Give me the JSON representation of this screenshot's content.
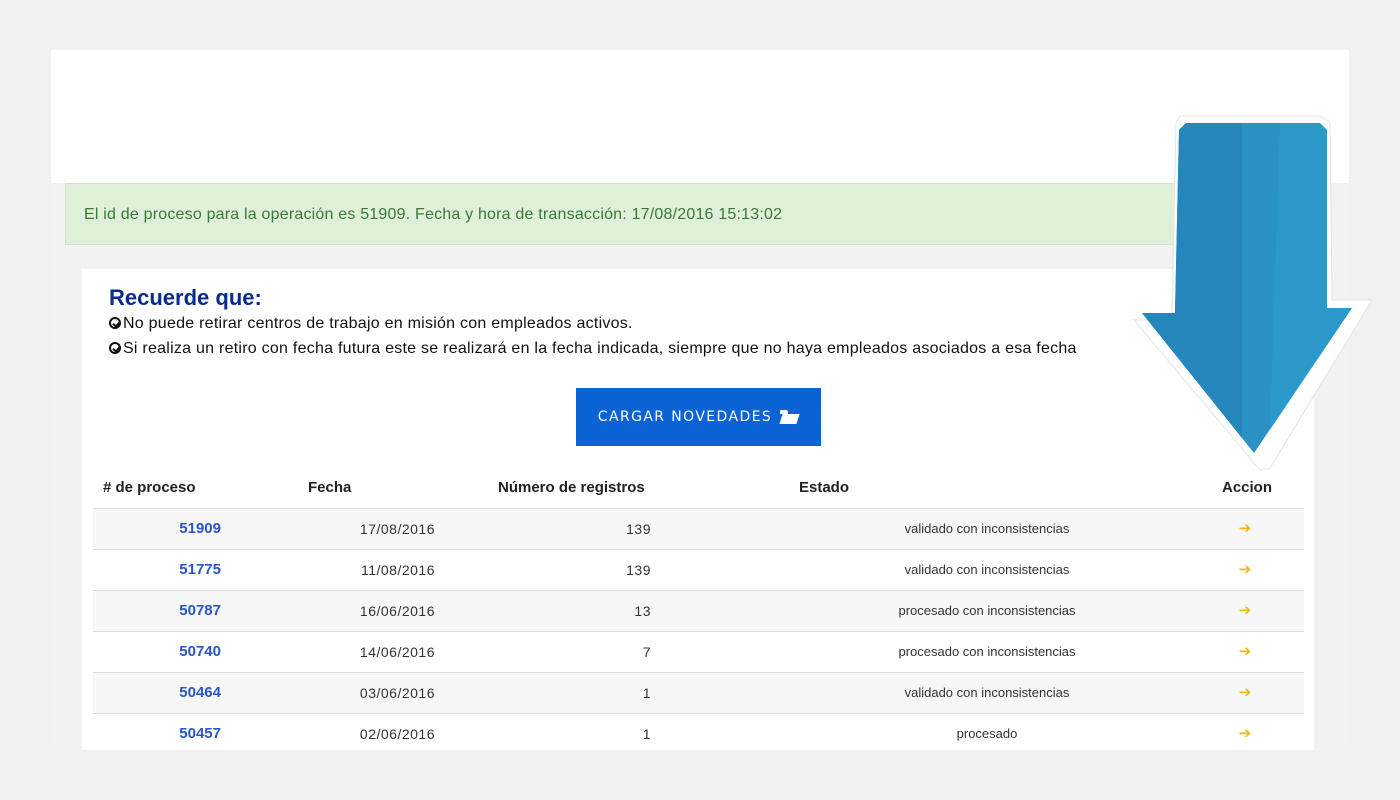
{
  "alert": {
    "message": "El id de proceso para la operación es 51909. Fecha y hora de transacción: 17/08/2016 15:13:02"
  },
  "reminder": {
    "title": "Recuerde que:",
    "items": [
      "No puede retirar centros de trabajo en misión con empleados activos.",
      "Si realiza un retiro con fecha futura este se realizará en la fecha indicada, siempre que no haya empleados asociados a esa fecha"
    ]
  },
  "upload_button": {
    "label": "CARGAR NOVEDADES",
    "icon": "folder-open-icon"
  },
  "table": {
    "headers": {
      "id": "# de proceso",
      "date": "Fecha",
      "records": "Número de registros",
      "status": "Estado",
      "action": "Accion"
    },
    "rows": [
      {
        "id": "51909",
        "date": "17/08/2016",
        "records": "139",
        "status": "validado con inconsistencias",
        "action": "➔"
      },
      {
        "id": "51775",
        "date": "11/08/2016",
        "records": "139",
        "status": "validado con inconsistencias",
        "action": "➔"
      },
      {
        "id": "50787",
        "date": "16/06/2016",
        "records": "13",
        "status": "procesado con inconsistencias",
        "action": "➔"
      },
      {
        "id": "50740",
        "date": "14/06/2016",
        "records": "7",
        "status": "procesado con inconsistencias",
        "action": "➔"
      },
      {
        "id": "50464",
        "date": "03/06/2016",
        "records": "1",
        "status": "validado con inconsistencias",
        "action": "➔"
      },
      {
        "id": "50457",
        "date": "02/06/2016",
        "records": "1",
        "status": "procesado",
        "action": "➔"
      }
    ]
  },
  "colors": {
    "alert_bg": "#dff0d8",
    "alert_text": "#3c763d",
    "title": "#0a2d8c",
    "button": "#0b63d6",
    "link": "#2a55c4",
    "action_arrow": "#f1b90a",
    "overlay_arrow": "#2a92c4"
  },
  "overlay": {
    "icon": "down-arrow-icon"
  }
}
